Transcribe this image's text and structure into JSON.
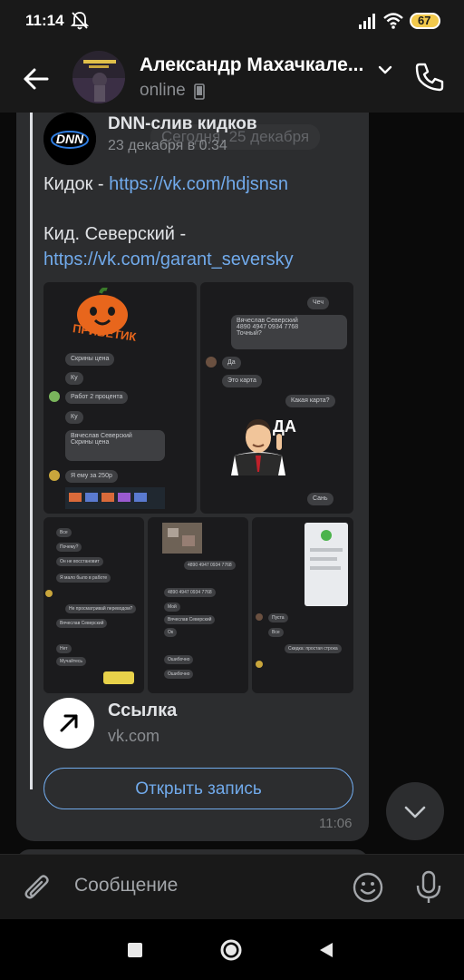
{
  "status_bar": {
    "time": "11:14",
    "battery": "67"
  },
  "header": {
    "title": "Александр Махачкале...",
    "status": "online",
    "avatar_caption": "НЕ СМОТРИ"
  },
  "message": {
    "date_pill": "Сегодня, 25 декабря",
    "post_author": "DNN-слив кидков",
    "post_date": "23 декабря в 0:34",
    "post_avatar_text": "DNN",
    "line1_label": "Кидок - ",
    "line1_link": "https://vk.com/hdjsnsn",
    "line2_label": "Кид. Северский -",
    "line2_link": "https://vk.com/garant_seversky",
    "link_card_title": "Ссылка",
    "link_card_domain": "vk.com",
    "open_button": "Открыть запись",
    "time": "11:06"
  },
  "photo1": {
    "sticker_text": "ПРИВЕТИК",
    "messages": [
      "Скрины цена",
      "Ку",
      "Работ 2 процента",
      "Ку",
      "Я ему за 250р"
    ],
    "quote_name": "Вячеслав Северский",
    "quote_text": "Скрины цена"
  },
  "photo2": {
    "messages": [
      "Чеч",
      "Точный?",
      "Да",
      "Это карта",
      "Какая карта?",
      "Сань"
    ],
    "quote_name": "Вячеслав Северский",
    "quote_text": "4890 4947 0934 7768",
    "sticker_text": "ДА"
  },
  "photo3": {
    "messages": [
      "Все",
      "Почему?",
      "Он не восстановит",
      "Я мало было в работе",
      "Не просматривай переводом?",
      "Вячеслав Северский",
      "Нет",
      "Мучайтесь"
    ]
  },
  "photo4": {
    "messages": [
      "4890 4947 0934 7768",
      "Вот карта",
      "Мой",
      "Вячеслав Северский",
      "Ок",
      "Ошибочно"
    ]
  },
  "photo5": {
    "messages": [
      "Пуста",
      "Все",
      "Скидка: простая строка"
    ]
  },
  "composer": {
    "placeholder": "Сообщение"
  },
  "colors": {
    "accent_link": "#71aaeb",
    "bubble": "#2c2d2f",
    "background": "#0a0a0a",
    "bar": "#191919"
  }
}
